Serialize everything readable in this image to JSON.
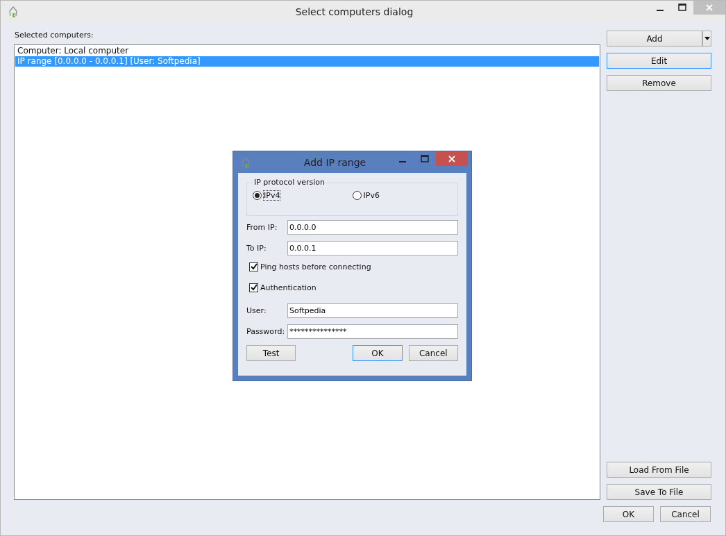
{
  "window": {
    "title": "Select computers dialog"
  },
  "list_label": "Selected computers:",
  "computers": [
    {
      "label": "Computer: Local computer",
      "selected": false
    },
    {
      "label": "IP range [0.0.0.0 - 0.0.0.1] [User: Softpedia]",
      "selected": true
    }
  ],
  "side_buttons": [
    {
      "label": "Add",
      "focused": false,
      "kind": "split"
    },
    {
      "label": "Edit",
      "focused": true,
      "kind": "plain"
    },
    {
      "label": "Remove",
      "focused": false,
      "kind": "plain"
    }
  ],
  "file_buttons": [
    {
      "label": "Load From File",
      "focused": false
    },
    {
      "label": "Save To File",
      "focused": false
    }
  ],
  "footer_buttons": [
    {
      "label": "OK",
      "focused": false
    },
    {
      "label": "Cancel",
      "focused": false
    }
  ],
  "dialog": {
    "title": "Add IP range",
    "group_label": "IP protocol version",
    "protocols": [
      {
        "label": "IPv4",
        "selected": true
      },
      {
        "label": "IPv6",
        "selected": false
      }
    ],
    "from": {
      "label": "From IP:",
      "value": "0.0.0.0"
    },
    "to": {
      "label": "To IP:",
      "value": "0.0.0.1"
    },
    "options": [
      {
        "label": "Ping hosts before connecting",
        "checked": true
      },
      {
        "label": "Authentication",
        "checked": true
      }
    ],
    "user": {
      "label": "User:",
      "value": "Softpedia"
    },
    "password": {
      "label": "Password:",
      "value": "***************"
    },
    "buttons": [
      {
        "label": "Test",
        "focused": false
      },
      {
        "label": "OK",
        "focused": true
      },
      {
        "label": "Cancel",
        "focused": false
      }
    ]
  }
}
